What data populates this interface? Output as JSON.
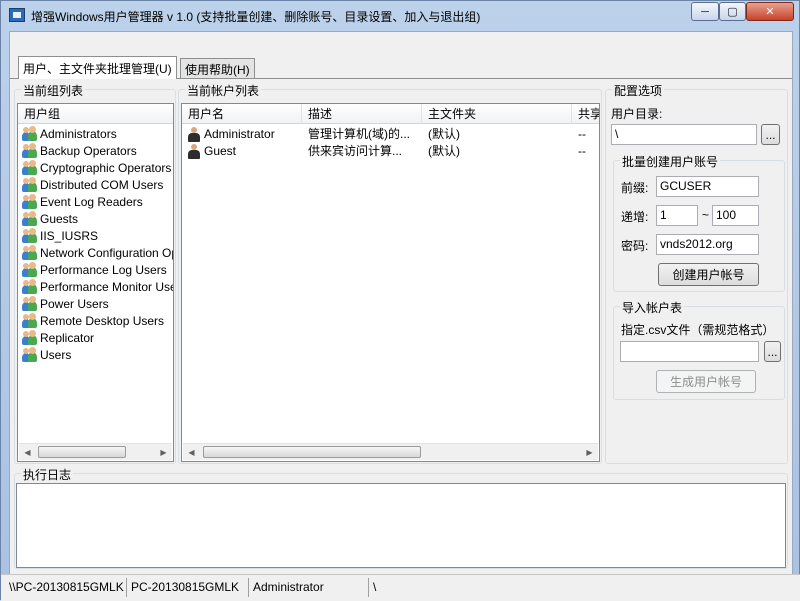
{
  "window": {
    "title": "增强Windows用户管理器 v 1.0 (支持批量创建、删除账号、目录设置、加入与退出组)",
    "min_glyph": "─",
    "max_glyph": "▢",
    "close_glyph": "✕"
  },
  "tabs": [
    {
      "label": "用户、主文件夹批理管理(U)"
    },
    {
      "label": "使用帮助(H)"
    }
  ],
  "groups_panel": {
    "title": "当前组列表",
    "header": "用户组",
    "items": [
      "Administrators",
      "Backup Operators",
      "Cryptographic Operators",
      "Distributed COM Users",
      "Event Log Readers",
      "Guests",
      "IIS_IUSRS",
      "Network Configuration Ope",
      "Performance Log Users",
      "Performance Monitor Users",
      "Power Users",
      "Remote Desktop Users",
      "Replicator",
      "Users"
    ]
  },
  "accounts_panel": {
    "title": "当前帐户列表",
    "columns": [
      "用户名",
      "描述",
      "主文件夹",
      "共享"
    ],
    "rows": [
      {
        "name": "Administrator",
        "desc": "管理计算机(域)的...",
        "home": "(默认)",
        "share": "--"
      },
      {
        "name": "Guest",
        "desc": "供来宾访问计算...",
        "home": "(默认)",
        "share": "--"
      }
    ]
  },
  "config": {
    "title": "配置选项",
    "user_dir_label": "用户目录:",
    "user_dir_value": "\\",
    "browse_label": "...",
    "batch": {
      "title": "批量创建用户账号",
      "prefix_label": "前缀:",
      "prefix_value": "GCUSER",
      "increment_label": "递增:",
      "from_value": "1",
      "tilde": "~",
      "to_value": "100",
      "password_label": "密码:",
      "password_value": "vnds2012.org",
      "create_button": "创建用户帐号"
    },
    "import": {
      "title": "导入帐户表",
      "csv_label": "指定.csv文件（需规范格式）",
      "csv_value": "",
      "browse_label": "...",
      "generate_button": "生成用户帐号"
    }
  },
  "log": {
    "title": "执行日志"
  },
  "statusbar": {
    "panels": [
      "\\\\PC-20130815GMLK",
      "PC-20130815GMLK",
      "Administrator",
      "\\"
    ]
  },
  "colors": {
    "title_bg": "#bcd1ea",
    "close_button": "#c7432a",
    "client_bg": "#f0f0f0"
  }
}
